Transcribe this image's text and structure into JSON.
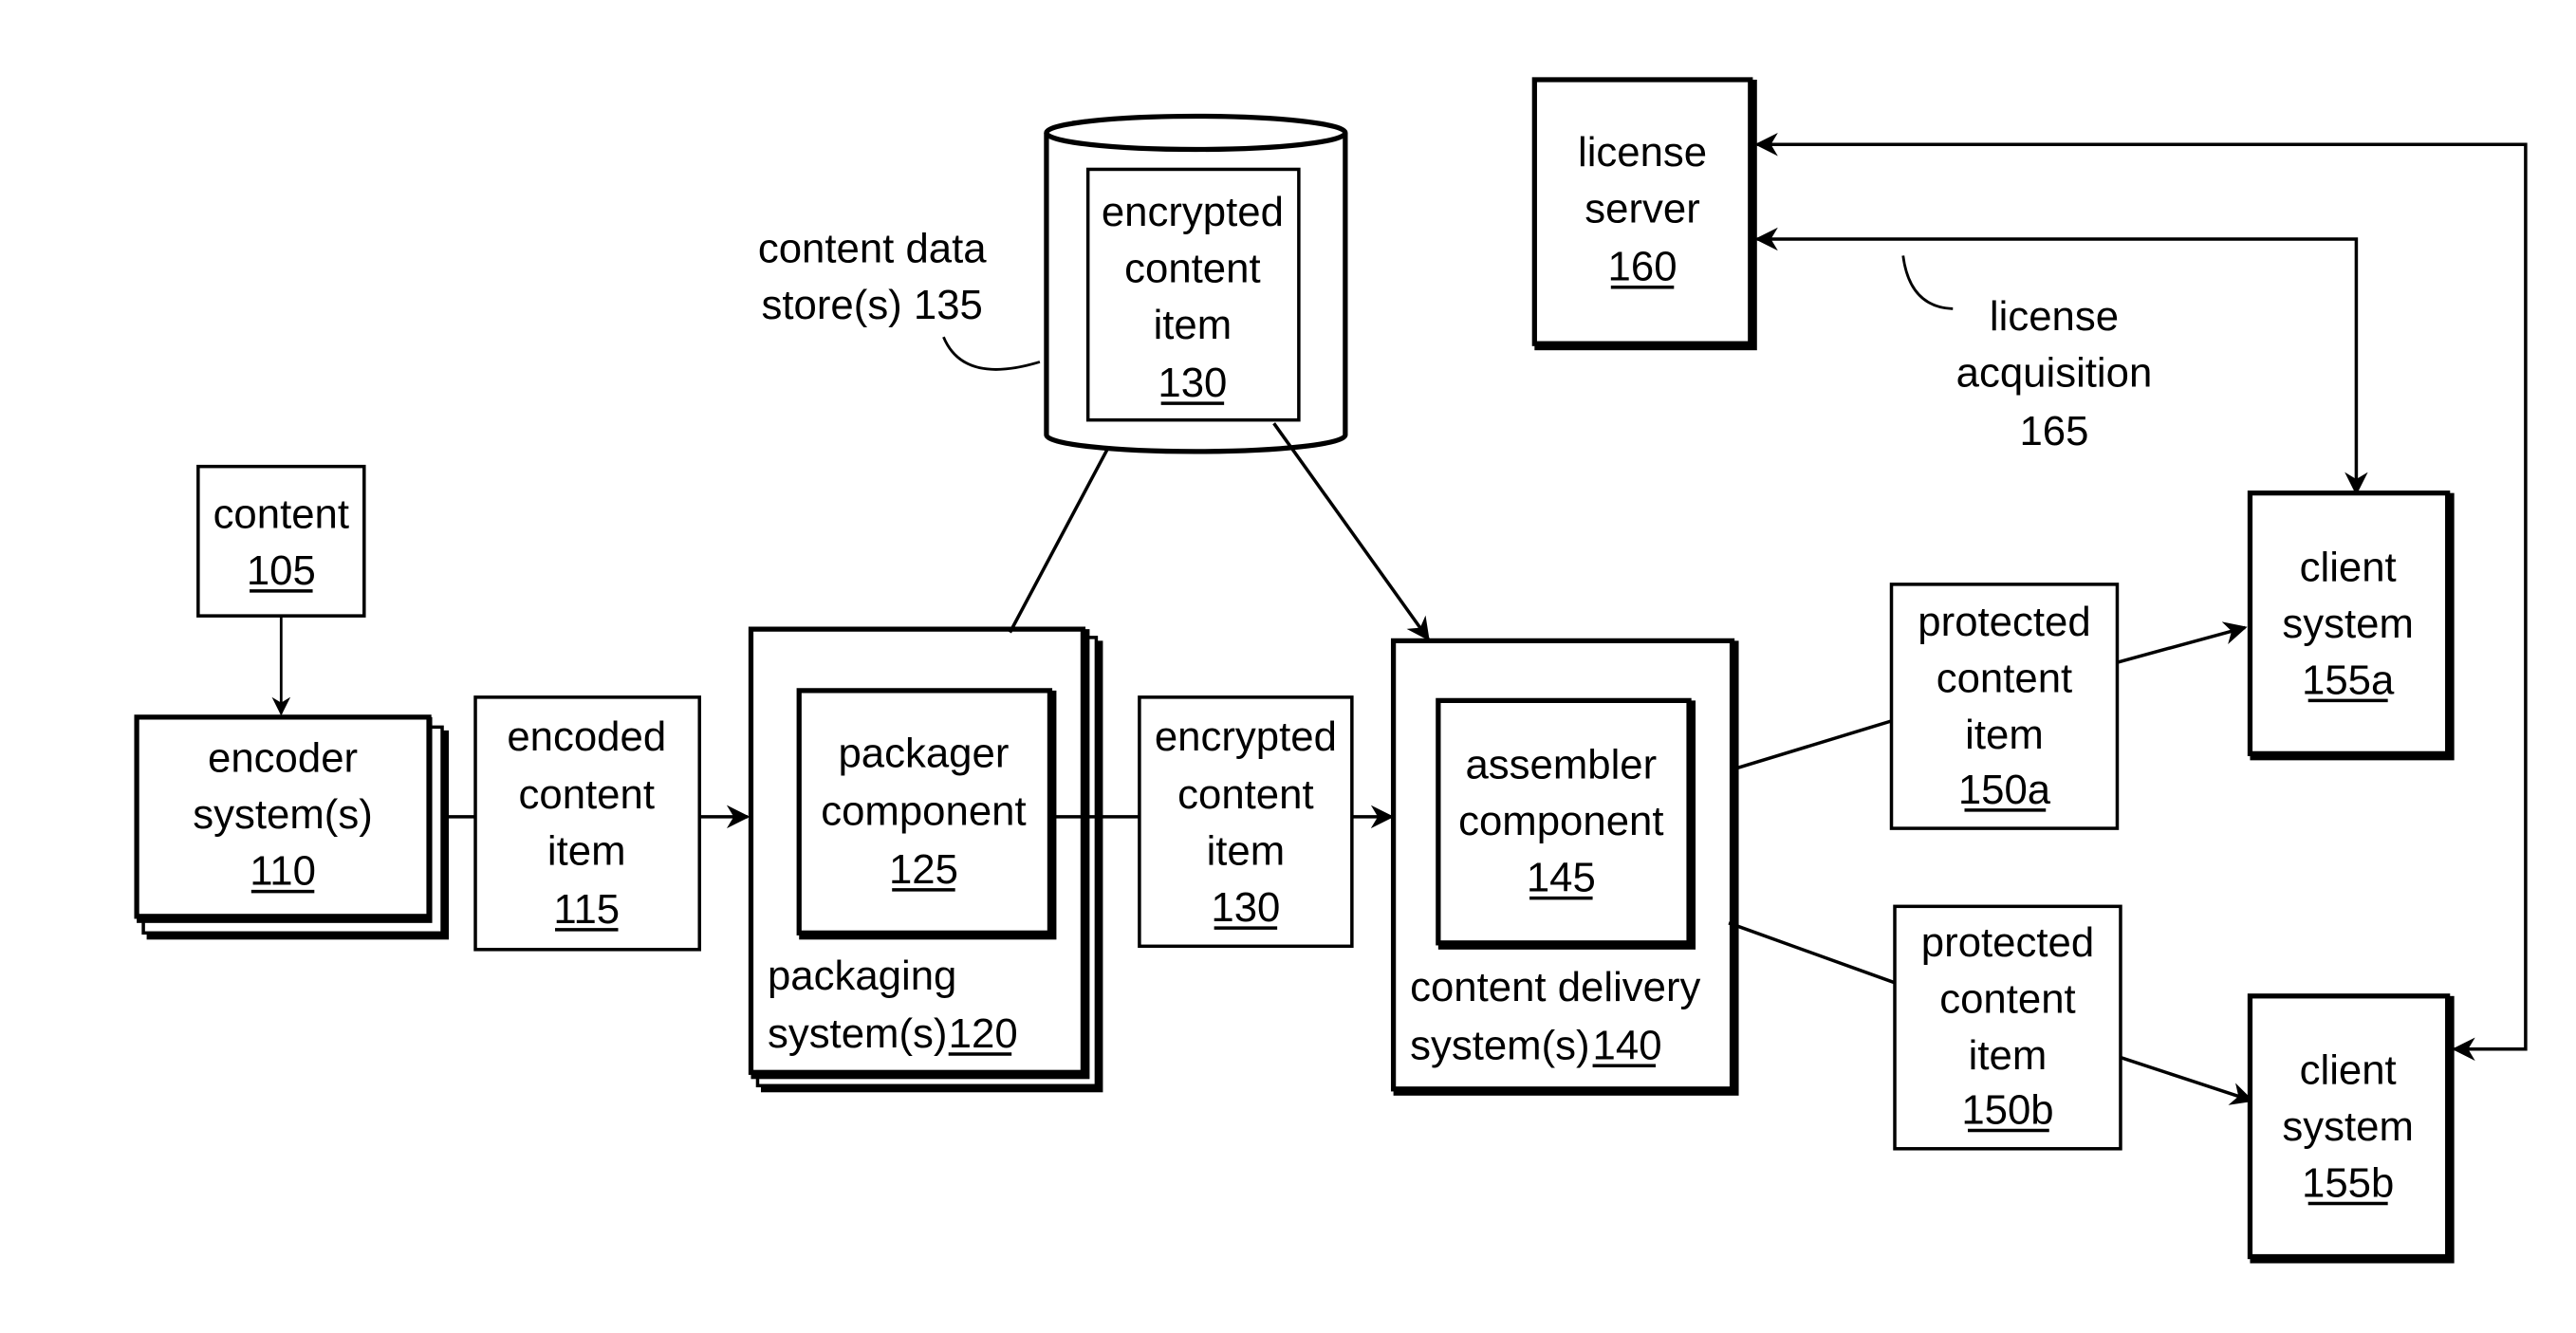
{
  "diagram": {
    "type": "system-block-diagram",
    "nodes": {
      "content": {
        "lines": [
          "content"
        ],
        "ref": "105"
      },
      "encoder": {
        "lines": [
          "encoder",
          "system(s)"
        ],
        "ref": "110"
      },
      "encoded_item": {
        "lines": [
          "encoded",
          "content",
          "item"
        ],
        "ref": "115"
      },
      "packager_component": {
        "lines": [
          "packager",
          "component"
        ],
        "ref": "125"
      },
      "packaging_system": {
        "lines": [
          "packaging",
          "system(s)"
        ],
        "ref": "120"
      },
      "encrypted_item_flow": {
        "lines": [
          "encrypted",
          "content",
          "item"
        ],
        "ref": "130"
      },
      "encrypted_item_store": {
        "lines": [
          "encrypted",
          "content",
          "item"
        ],
        "ref": "130"
      },
      "data_store_label": {
        "lines": [
          "content data",
          "store(s) 135"
        ]
      },
      "assembler_component": {
        "lines": [
          "assembler",
          "component"
        ],
        "ref": "145"
      },
      "content_delivery": {
        "lines": [
          "content delivery",
          "system(s)"
        ],
        "ref": "140"
      },
      "protected_a": {
        "lines": [
          "protected",
          "content",
          "item"
        ],
        "ref": "150a"
      },
      "protected_b": {
        "lines": [
          "protected",
          "content",
          "item"
        ],
        "ref": "150b"
      },
      "client_a": {
        "lines": [
          "client",
          "system"
        ],
        "ref": "155a"
      },
      "client_b": {
        "lines": [
          "client",
          "system"
        ],
        "ref": "155b"
      },
      "license_server": {
        "lines": [
          "license",
          "server"
        ],
        "ref": "160"
      },
      "license_acquisition": {
        "lines": [
          "license",
          "acquisition",
          "165"
        ]
      }
    },
    "edges": [
      {
        "from": "content",
        "to": "encoder"
      },
      {
        "from": "encoder",
        "to": "packaging_system",
        "via": "encoded_item"
      },
      {
        "from": "packaging_system",
        "to": "content_data_store"
      },
      {
        "from": "packaging_system",
        "to": "content_delivery",
        "via": "encrypted_item_flow"
      },
      {
        "from": "content_data_store",
        "to": "content_delivery"
      },
      {
        "from": "content_delivery",
        "to": "client_a",
        "via": "protected_a"
      },
      {
        "from": "content_delivery",
        "to": "client_b",
        "via": "protected_b"
      },
      {
        "from": "client_a",
        "to": "license_server",
        "bidirectional": true,
        "label": "license_acquisition"
      },
      {
        "from": "client_b",
        "to": "license_server",
        "bidirectional": true
      }
    ]
  }
}
